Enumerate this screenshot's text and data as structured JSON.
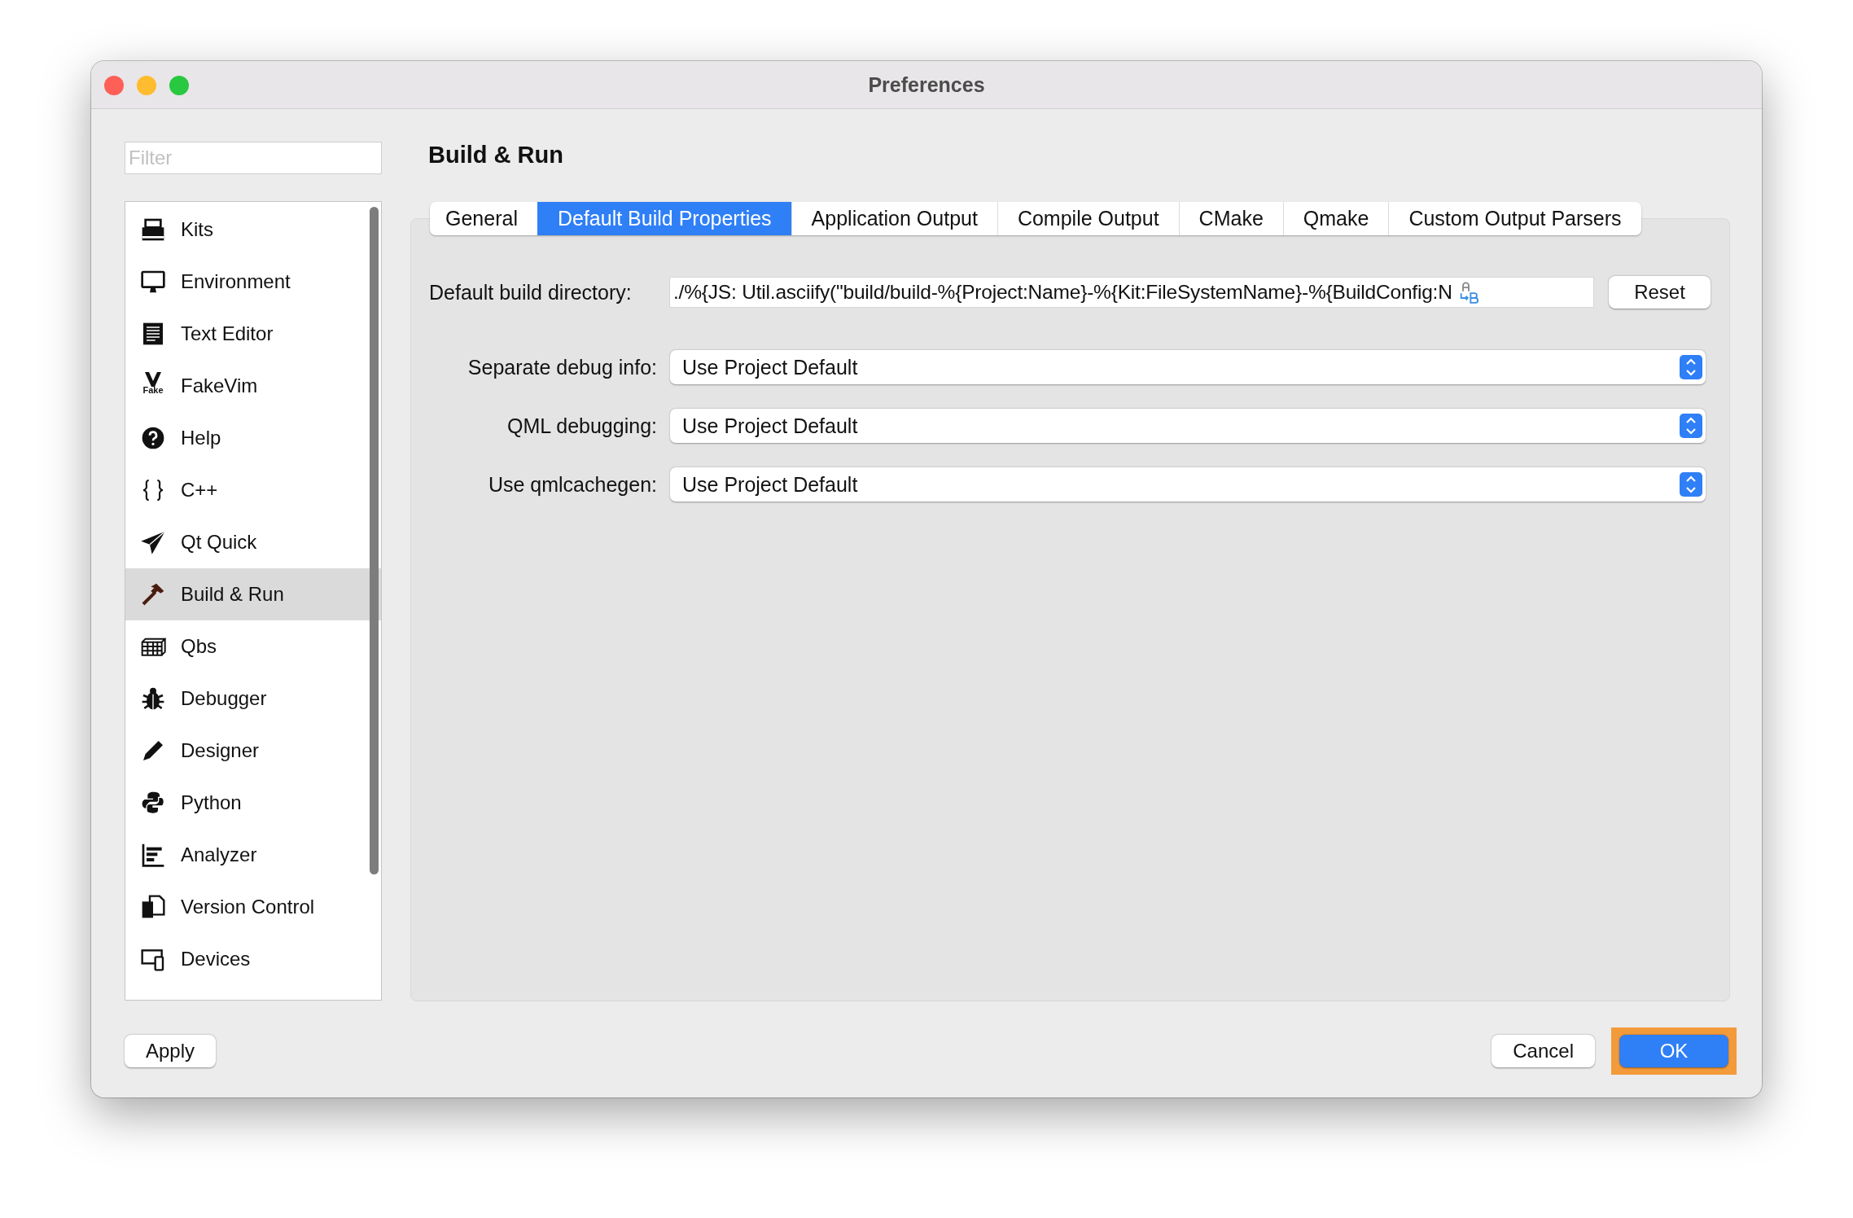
{
  "window": {
    "title": "Preferences"
  },
  "sidebar": {
    "filter_placeholder": "Filter",
    "items": [
      {
        "label": "Kits",
        "selected": false
      },
      {
        "label": "Environment",
        "selected": false
      },
      {
        "label": "Text Editor",
        "selected": false
      },
      {
        "label": "FakeVim",
        "selected": false,
        "icon_text": "Fake"
      },
      {
        "label": "Help",
        "selected": false
      },
      {
        "label": "C++",
        "selected": false
      },
      {
        "label": "Qt Quick",
        "selected": false
      },
      {
        "label": "Build & Run",
        "selected": true
      },
      {
        "label": "Qbs",
        "selected": false
      },
      {
        "label": "Debugger",
        "selected": false
      },
      {
        "label": "Designer",
        "selected": false
      },
      {
        "label": "Python",
        "selected": false
      },
      {
        "label": "Analyzer",
        "selected": false
      },
      {
        "label": "Version Control",
        "selected": false
      },
      {
        "label": "Devices",
        "selected": false
      }
    ]
  },
  "page_title": "Build & Run",
  "tabs": [
    {
      "label": "General",
      "selected": false
    },
    {
      "label": "Default Build Properties",
      "selected": true
    },
    {
      "label": "Application Output",
      "selected": false
    },
    {
      "label": "Compile Output",
      "selected": false
    },
    {
      "label": "CMake",
      "selected": false
    },
    {
      "label": "Qmake",
      "selected": false
    },
    {
      "label": "Custom Output Parsers",
      "selected": false
    }
  ],
  "build_directory": {
    "label": "Default build directory:",
    "value": "./%{JS: Util.asciify(\"build/build-%{Project:Name}-%{Kit:FileSystemName}-%{BuildConfig:N",
    "reset": "Reset"
  },
  "settings": [
    {
      "label": "Separate debug info:",
      "value": "Use Project Default"
    },
    {
      "label": "QML debugging:",
      "value": "Use Project Default"
    },
    {
      "label": "Use qmlcachegen:",
      "value": "Use Project Default"
    }
  ],
  "buttons": {
    "apply": "Apply",
    "cancel": "Cancel",
    "ok": {
      "label": "OK",
      "highlighted": true
    }
  }
}
